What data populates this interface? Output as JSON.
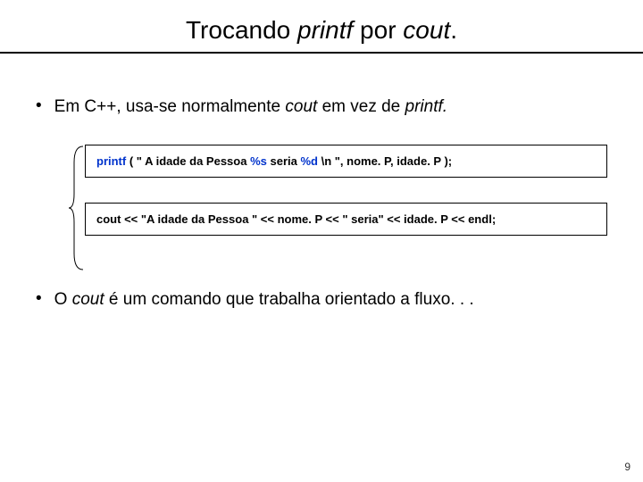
{
  "title": {
    "part1": "Trocando ",
    "italic1": "printf",
    "part2": " por ",
    "italic2": "cout",
    "part3": "."
  },
  "bullet1": {
    "p1": "Em C++, usa-se normalmente ",
    "it1": "cout",
    "p2": " em vez de ",
    "it2": "printf."
  },
  "code1": {
    "kw": "printf",
    "t1": " ( \" A idade da  Pessoa  ",
    "fmt1": "%s",
    "t2": "  seria  ",
    "fmt2": "%d",
    "t3": "   \\n  \",   nome. P,   idade. P );"
  },
  "code2": {
    "kw": "cout",
    "t1": " << \"A idade da Pessoa \" << nome. P << \" seria\" << idade. P << ",
    "kw2": "endl",
    "t2": ";"
  },
  "bullet2": {
    "p1": "O ",
    "it1": "cout",
    "p2": " é um comando que trabalha orientado a fluxo. . ."
  },
  "pagenum": "9"
}
